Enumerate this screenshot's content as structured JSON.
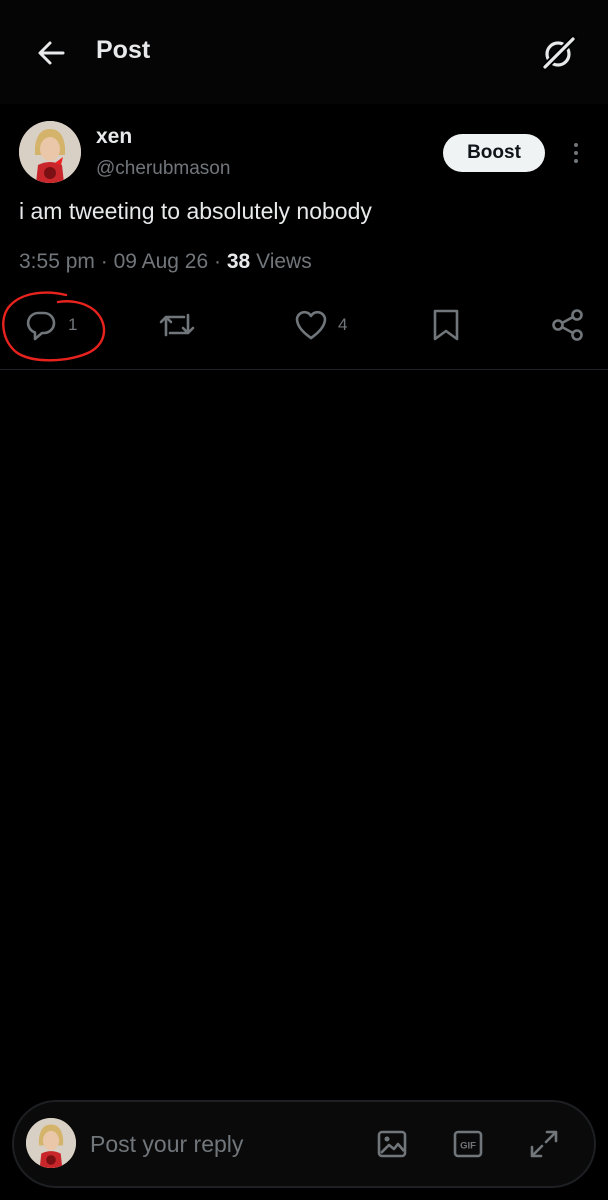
{
  "header": {
    "title": "Post",
    "back_icon": "arrow-left-icon",
    "grok_icon": "grok-icon"
  },
  "post": {
    "author": {
      "display_name": "xen",
      "handle": "@cherubmason"
    },
    "boost_label": "Boost",
    "text": "i am tweeting to absolutely nobody",
    "time": "3:55 pm",
    "date": "09 Aug 26",
    "views_count": "38",
    "views_label": "Views",
    "separator": "·"
  },
  "actions": {
    "replies": "1",
    "likes": "4"
  },
  "reply_bar": {
    "placeholder": "Post your reply"
  },
  "colors": {
    "background": "#000000",
    "text_primary": "#e7e9ea",
    "text_secondary": "#71767b",
    "boost_bg": "#eff3f4",
    "annotation_red": "#e8231e"
  }
}
